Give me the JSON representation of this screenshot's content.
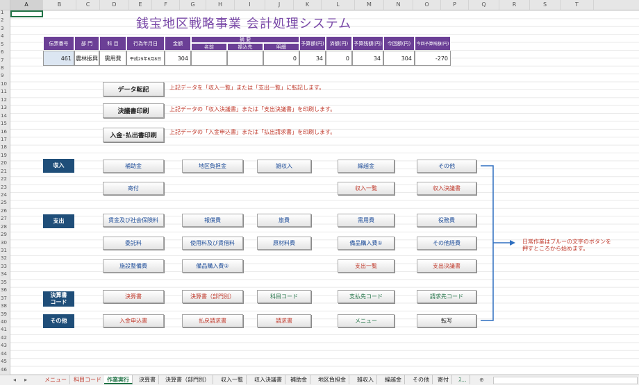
{
  "title": "銭宝地区戦略事業 会計処理システム",
  "columns": [
    "A",
    "B",
    "C",
    "D",
    "E",
    "F",
    "G",
    "H",
    "I",
    "J",
    "K",
    "L",
    "M",
    "N",
    "O",
    "P",
    "Q",
    "R",
    "S",
    "T"
  ],
  "rows": [
    "1",
    "2",
    "3",
    "4",
    "5",
    "6",
    "7",
    "8",
    "9",
    "10",
    "11",
    "12",
    "13",
    "14",
    "15",
    "16",
    "17",
    "18",
    "19",
    "20",
    "21",
    "22",
    "23",
    "24",
    "25",
    "26",
    "27",
    "28",
    "29",
    "30",
    "31",
    "32",
    "33",
    "34",
    "35",
    "36",
    "37",
    "38",
    "39",
    "40",
    "41",
    "42",
    "43",
    "44",
    "45",
    "46"
  ],
  "table": {
    "headers": {
      "voucher": "伝票番号",
      "dept": "部 門",
      "subject": "科 目",
      "date": "行為年月日",
      "amount": "金額",
      "summary": "摘 要",
      "name": "名前",
      "transfer": "振込先",
      "detail": "明細",
      "budget": "予算額(円)",
      "spent": "済額(円)",
      "remaining": "予算残額(円)",
      "current": "今回額(円)",
      "after": "今回予算残額(円)"
    },
    "row": {
      "voucher": "461",
      "dept": "農林振興",
      "subject": "需用費",
      "date": "平成29年6月8日",
      "amount": "304",
      "name": "",
      "transfer": "",
      "detail": "0",
      "budget": "34",
      "spent": "0",
      "remaining": "34",
      "current": "304",
      "after": "-270"
    }
  },
  "actions": {
    "transfer": {
      "label": "データ転記",
      "desc": "上記データを「収入一覧」または「支出一覧」に転記します。"
    },
    "print_decision": {
      "label": "決議書印刷",
      "desc": "上記データの「収入決議書」または「支出決議書」を印刷します。"
    },
    "print_request": {
      "label": "入金･払出書印刷",
      "desc": "上記データの「入金申込書」または「払出請求書」を印刷します。"
    }
  },
  "sections": {
    "income": "収入",
    "expense": "支出",
    "settlement": "決算書コード",
    "other": "その他"
  },
  "income_buttons": [
    "補助金",
    "地区負担金",
    "雑収入",
    "繰越金",
    "その他",
    "寄付",
    "収入一覧",
    "収入決議書"
  ],
  "expense_buttons": [
    "賃金及び社会保険料",
    "報償費",
    "旅費",
    "需用費",
    "役務費",
    "委託料",
    "使用料及び賃借料",
    "原材料費",
    "備品購入費①",
    "その他経費",
    "施設整備費",
    "備品購入費②",
    "支出一覧",
    "支出決議書"
  ],
  "settlement_buttons": [
    "決算書",
    "決算書（部門別）",
    "科目コード",
    "支払先コード",
    "請求先コード"
  ],
  "other_buttons": [
    "入金申込書",
    "払戻請求書",
    "請求書",
    "メニュー",
    "転写"
  ],
  "note": [
    "日常作業はブルーの文字のボタンを",
    "押すところから始めます。"
  ],
  "tabs": [
    "メニュー",
    "科目コード",
    "作業実行",
    "決算書",
    "決算書（部門別）",
    "収入一覧",
    "収入決議書",
    "補助金",
    "地区負担金",
    "雑収入",
    "繰越金",
    "その他",
    "寄付"
  ],
  "tab_more": "ｽ...",
  "tab_add": "⊕",
  "colors": {
    "header_purple": "#6b3f96",
    "section_blue": "#1f4e79",
    "accent_green": "#217346",
    "note_red": "#c0392b"
  }
}
